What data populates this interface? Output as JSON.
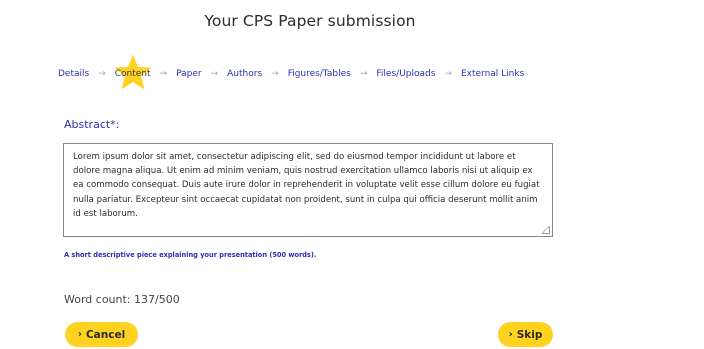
{
  "page": {
    "title": "Your CPS Paper submission"
  },
  "steps": {
    "items": [
      {
        "label": "Details"
      },
      {
        "label": "Content"
      },
      {
        "label": "Paper"
      },
      {
        "label": "Authors"
      },
      {
        "label": "Figures/Tables"
      },
      {
        "label": "Files/Uploads"
      },
      {
        "label": "External Links"
      }
    ],
    "current": "Content",
    "separator": "→"
  },
  "abstract": {
    "label": "Abstract*:",
    "value": "Lorem ipsum dolor sit amet, consectetur adipiscing elit, sed do eiusmod tempor incididunt ut labore et dolore magna aliqua. Ut enim ad minim veniam, quis nostrud exercitation ullamco laboris nisi ut aliquip ex ea commodo consequat. Duis aute irure dolor in reprehenderit in voluptate velit esse cillum dolore eu fugiat nulla pariatur. Excepteur sint occaecat cupidatat non proident, sunt in culpa qui officia deserunt mollit anim id est laborum.",
    "hint": "A short descriptive piece explaining your presentation (500 words).",
    "word_count": "Word count: 137/500"
  },
  "buttons": {
    "cancel_label": "Cancel",
    "skip_label": "Skip",
    "chevron": "›"
  },
  "colors": {
    "accent": "#2c2fae",
    "button": "#ffd21f",
    "star": "#ffd21f"
  }
}
